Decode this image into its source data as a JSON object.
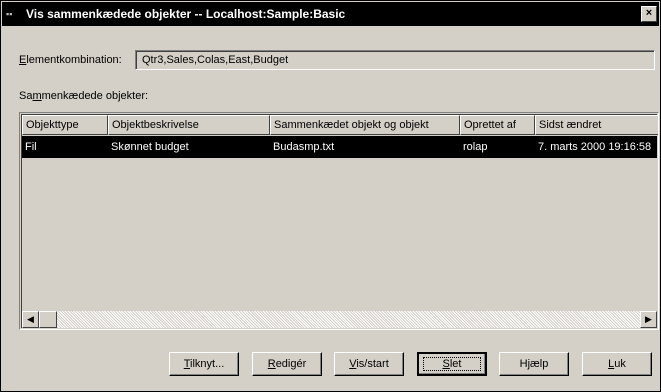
{
  "window": {
    "title": "Vis sammenkædede objekter -- Localhost:Sample:Basic",
    "close_glyph": "×"
  },
  "member_combo": {
    "label_underlined": "E",
    "label_rest": "lementkombination:",
    "value": "Qtr3,Sales,Colas,East,Budget"
  },
  "linked_objects": {
    "label_pre": "Sa",
    "label_underlined": "m",
    "label_rest": "menkædede objekter:",
    "columns": [
      "Objekttype",
      "Objektbeskrivelse",
      "Sammenkædet objekt og objekt",
      "Oprettet af",
      "Sidst ændret"
    ],
    "rows": [
      [
        "Fil",
        "Skønnet budget",
        "Budasmp.txt",
        "rolap",
        "7. marts 2000 19:16:58"
      ]
    ]
  },
  "scrollbar": {
    "left_arrow": "◀",
    "right_arrow": "▶"
  },
  "buttons": {
    "attach": {
      "u": "T",
      "rest": "ilknyt..."
    },
    "edit": {
      "u": "R",
      "rest": "edigér"
    },
    "view": {
      "u": "V",
      "rest": "is/start"
    },
    "delete": {
      "u": "S",
      "rest": "let"
    },
    "help": {
      "pre": "H",
      "u": "j",
      "rest": "ælp"
    },
    "close": {
      "u": "L",
      "rest": "uk"
    }
  }
}
